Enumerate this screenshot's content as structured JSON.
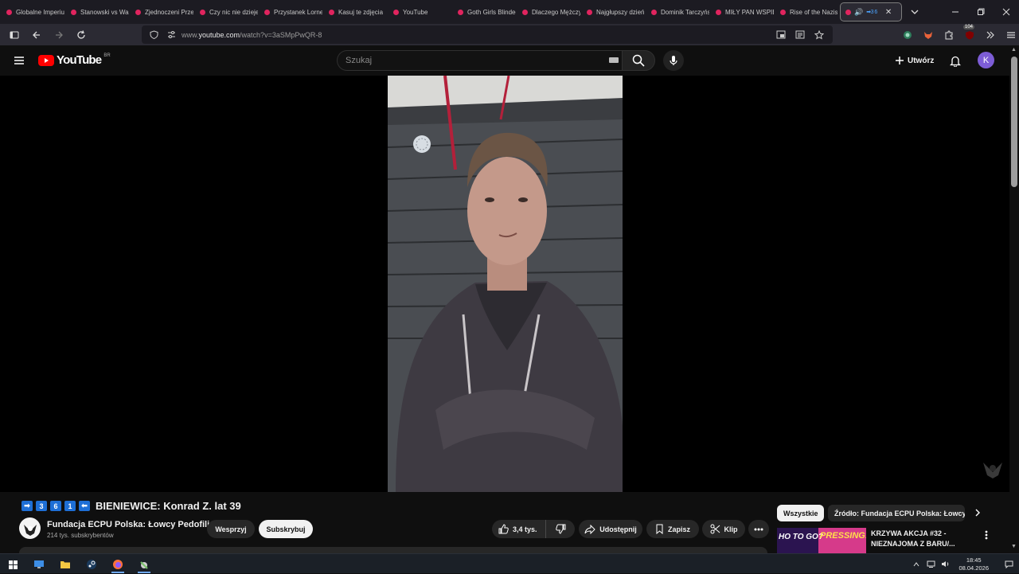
{
  "browser": {
    "tabs": [
      {
        "title": "Globalne Imperium"
      },
      {
        "title": "Stanowski vs Wardęga"
      },
      {
        "title": "Zjednoczeni Przeciw"
      },
      {
        "title": "Czy nic nie dzieje się"
      },
      {
        "title": "Przystanek Lornetka"
      },
      {
        "title": "Kasuj te zdjęcia"
      },
      {
        "title": "YouTube"
      },
      {
        "title": "Goth Girls Blinded"
      },
      {
        "title": "Dlaczego Mężczyźni"
      },
      {
        "title": "Najgłupszy dzień"
      },
      {
        "title": "Dominik Tarczyński"
      },
      {
        "title": "MIŁY PAN WSPIERA"
      },
      {
        "title": "Rise of the Nazis"
      }
    ],
    "active_tab": {
      "indicator": "➡3 6",
      "close": "✕"
    },
    "url_prefix": "www.",
    "url_domain": "youtube.com",
    "url_path": "/watch?v=3aSMpPwQR-8",
    "extension_badge": "104"
  },
  "youtube": {
    "logo_text": "YouTube",
    "region": "BR",
    "search_placeholder": "Szukaj",
    "create_label": "Utwórz",
    "avatar_letter": "K",
    "accent": "#ff0000"
  },
  "video": {
    "title_boxes": [
      "➡",
      "3",
      "6",
      "1",
      "⬅"
    ],
    "title": "BIENIEWICE: Konrad Z. lat 39",
    "channel_name": "Fundacja ECPU Polska: Łowcy Pedofili",
    "subscribers": "214 tys. subskrybentów",
    "join_label": "Wesprzyj",
    "subscribe_label": "Subskrybuj",
    "likes": "3,4 tys.",
    "share_label": "Udostępnij",
    "save_label": "Zapisz",
    "clip_label": "Klip"
  },
  "sidebar": {
    "chips": [
      "Wszystkie",
      "Źródło: Fundacja ECPU Polska: Łowcy Pedofili"
    ],
    "recommendation": {
      "title": "KRZYWA AKCJA #32 - NIEZNAJOMA Z BARU/...",
      "thumb_text_1": "HO TO GO?",
      "thumb_text_2": "PRESSING!"
    }
  },
  "taskbar": {
    "time": "18:45",
    "date": "08.04.2026"
  }
}
